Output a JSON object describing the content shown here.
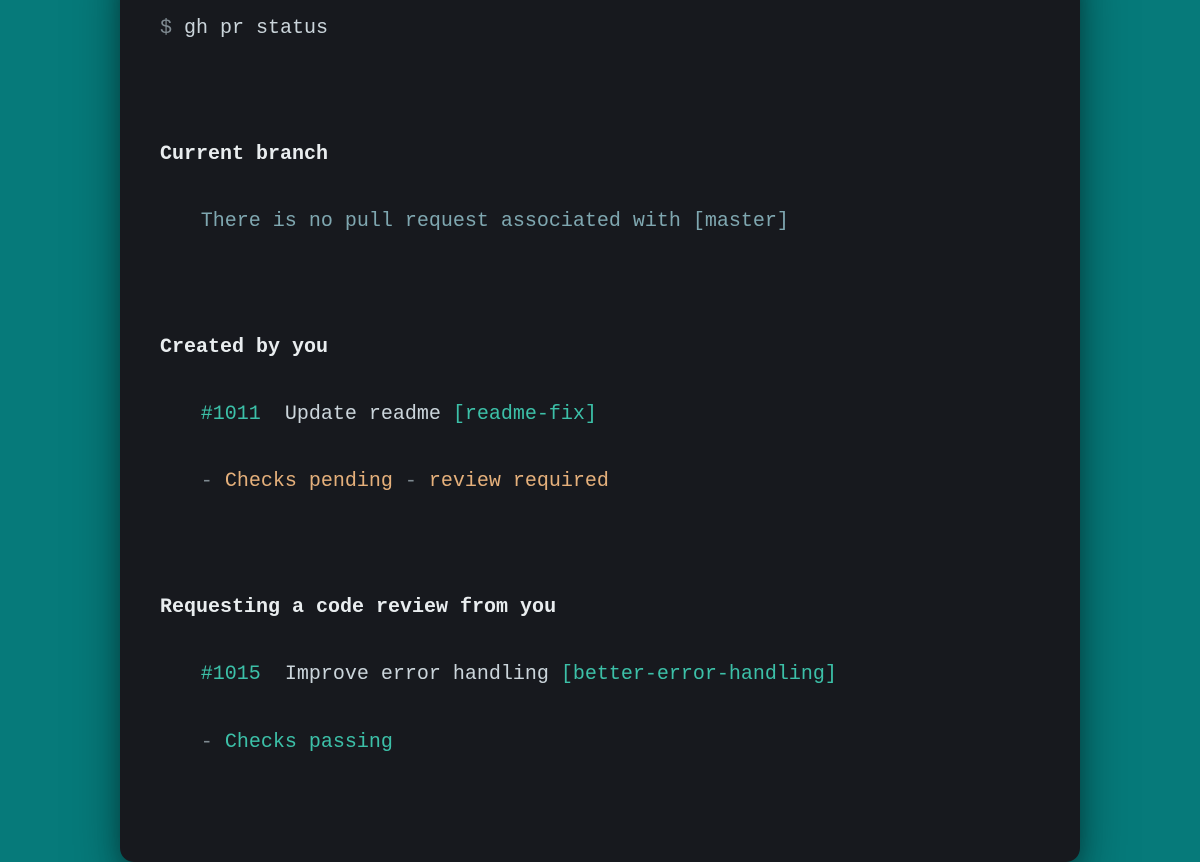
{
  "prompt": {
    "symbol": "$",
    "command": "gh pr status"
  },
  "sections": {
    "current": {
      "heading": "Current branch",
      "message_prefix": "There is no pull request associated with ",
      "branch": "[master]"
    },
    "created": {
      "heading": "Created by you",
      "pr": {
        "id": "#1011",
        "title": "Update readme",
        "branch": "[readme-fix]"
      },
      "status": {
        "dash1": "-",
        "checks": "Checks pending",
        "dash2": "-",
        "review": "review required"
      }
    },
    "requested": {
      "heading": "Requesting a code review from you",
      "pr": {
        "id": "#1015",
        "title": "Improve error handling",
        "branch": "[better-error-handling]"
      },
      "status": {
        "dash1": "-",
        "checks": "Checks passing"
      }
    }
  }
}
